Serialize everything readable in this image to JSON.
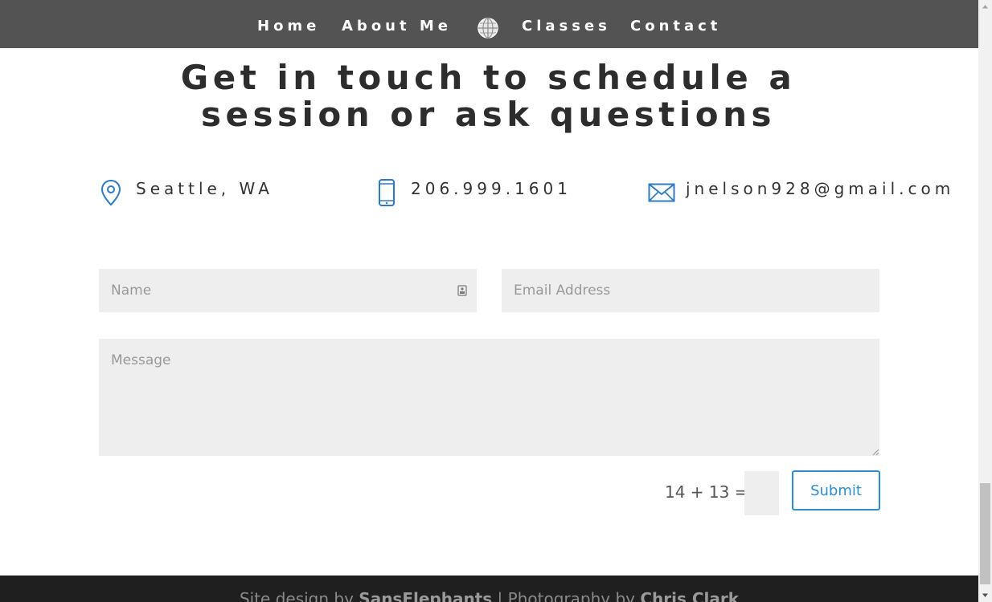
{
  "nav": {
    "home": "Home",
    "about": "About Me",
    "classes": "Classes",
    "contact": "Contact",
    "logo_icon": "globe-logo-icon"
  },
  "heading": "Get in touch to schedule a session or ask questions",
  "info": {
    "location": "Seattle, WA",
    "phone": "206.999.1601",
    "email": "jnelson928@gmail.com",
    "icons": [
      "map-pin-icon",
      "phone-icon",
      "envelope-icon"
    ]
  },
  "form": {
    "name_placeholder": "Name",
    "email_placeholder": "Email Address",
    "message_placeholder": "Message",
    "captcha_label": "14 + 13 =",
    "captcha_value": "",
    "submit_label": "Submit"
  },
  "footer": {
    "prefix": "Site design by",
    "designer": "SansElephants",
    "separator": "|",
    "photo_prefix": "Photography by",
    "photographer": "Chris Clark"
  },
  "colors": {
    "nav_bg": "#535353",
    "accent": "#2e8ece",
    "field_bg": "#eeeeee",
    "footer_bg": "#1f1f1f"
  }
}
